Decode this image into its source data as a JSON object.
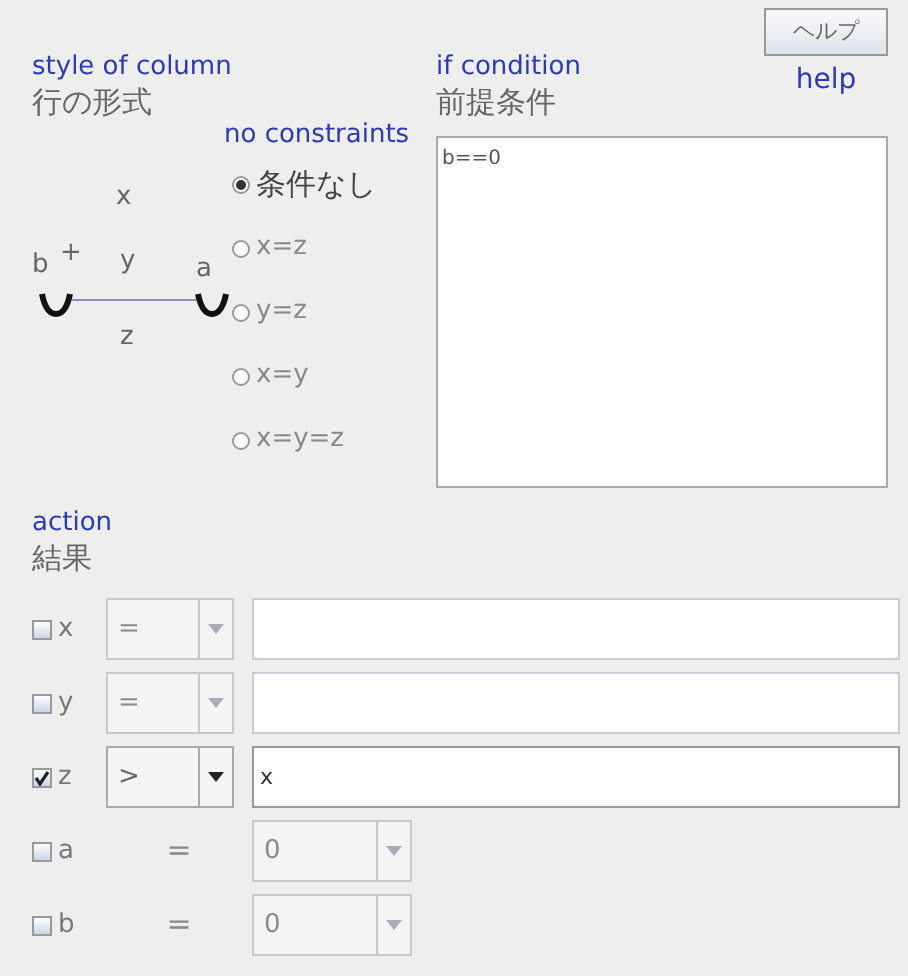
{
  "style_heading": {
    "en": "style of column",
    "ja": "行の形式"
  },
  "diagram": {
    "labels": [
      "x",
      "b",
      "+",
      "y",
      "a",
      "z"
    ]
  },
  "constraints": {
    "heading": "no constraints",
    "options": [
      {
        "label": "条件なし",
        "selected": true
      },
      {
        "label": "x=z",
        "selected": false
      },
      {
        "label": "y=z",
        "selected": false
      },
      {
        "label": "x=y",
        "selected": false
      },
      {
        "label": "x=y=z",
        "selected": false
      }
    ]
  },
  "condition": {
    "heading_en": "if condition",
    "heading_ja": "前提条件",
    "value": "b==0"
  },
  "help": {
    "button": "ヘルプ",
    "caption": "help"
  },
  "action": {
    "heading_en": "action",
    "heading_ja": "結果",
    "rows": [
      {
        "kind": "expression",
        "label": "x",
        "checked": false,
        "operator": "="
      },
      {
        "kind": "expression",
        "label": "y",
        "checked": false,
        "operator": "="
      },
      {
        "kind": "expression",
        "label": "z",
        "checked": true,
        "operator": ">",
        "value": "x"
      },
      {
        "kind": "constant",
        "label": "a",
        "checked": false,
        "operator": "=",
        "value": "0"
      },
      {
        "kind": "constant",
        "label": "b",
        "checked": false,
        "operator": "=",
        "value": "0"
      }
    ]
  }
}
